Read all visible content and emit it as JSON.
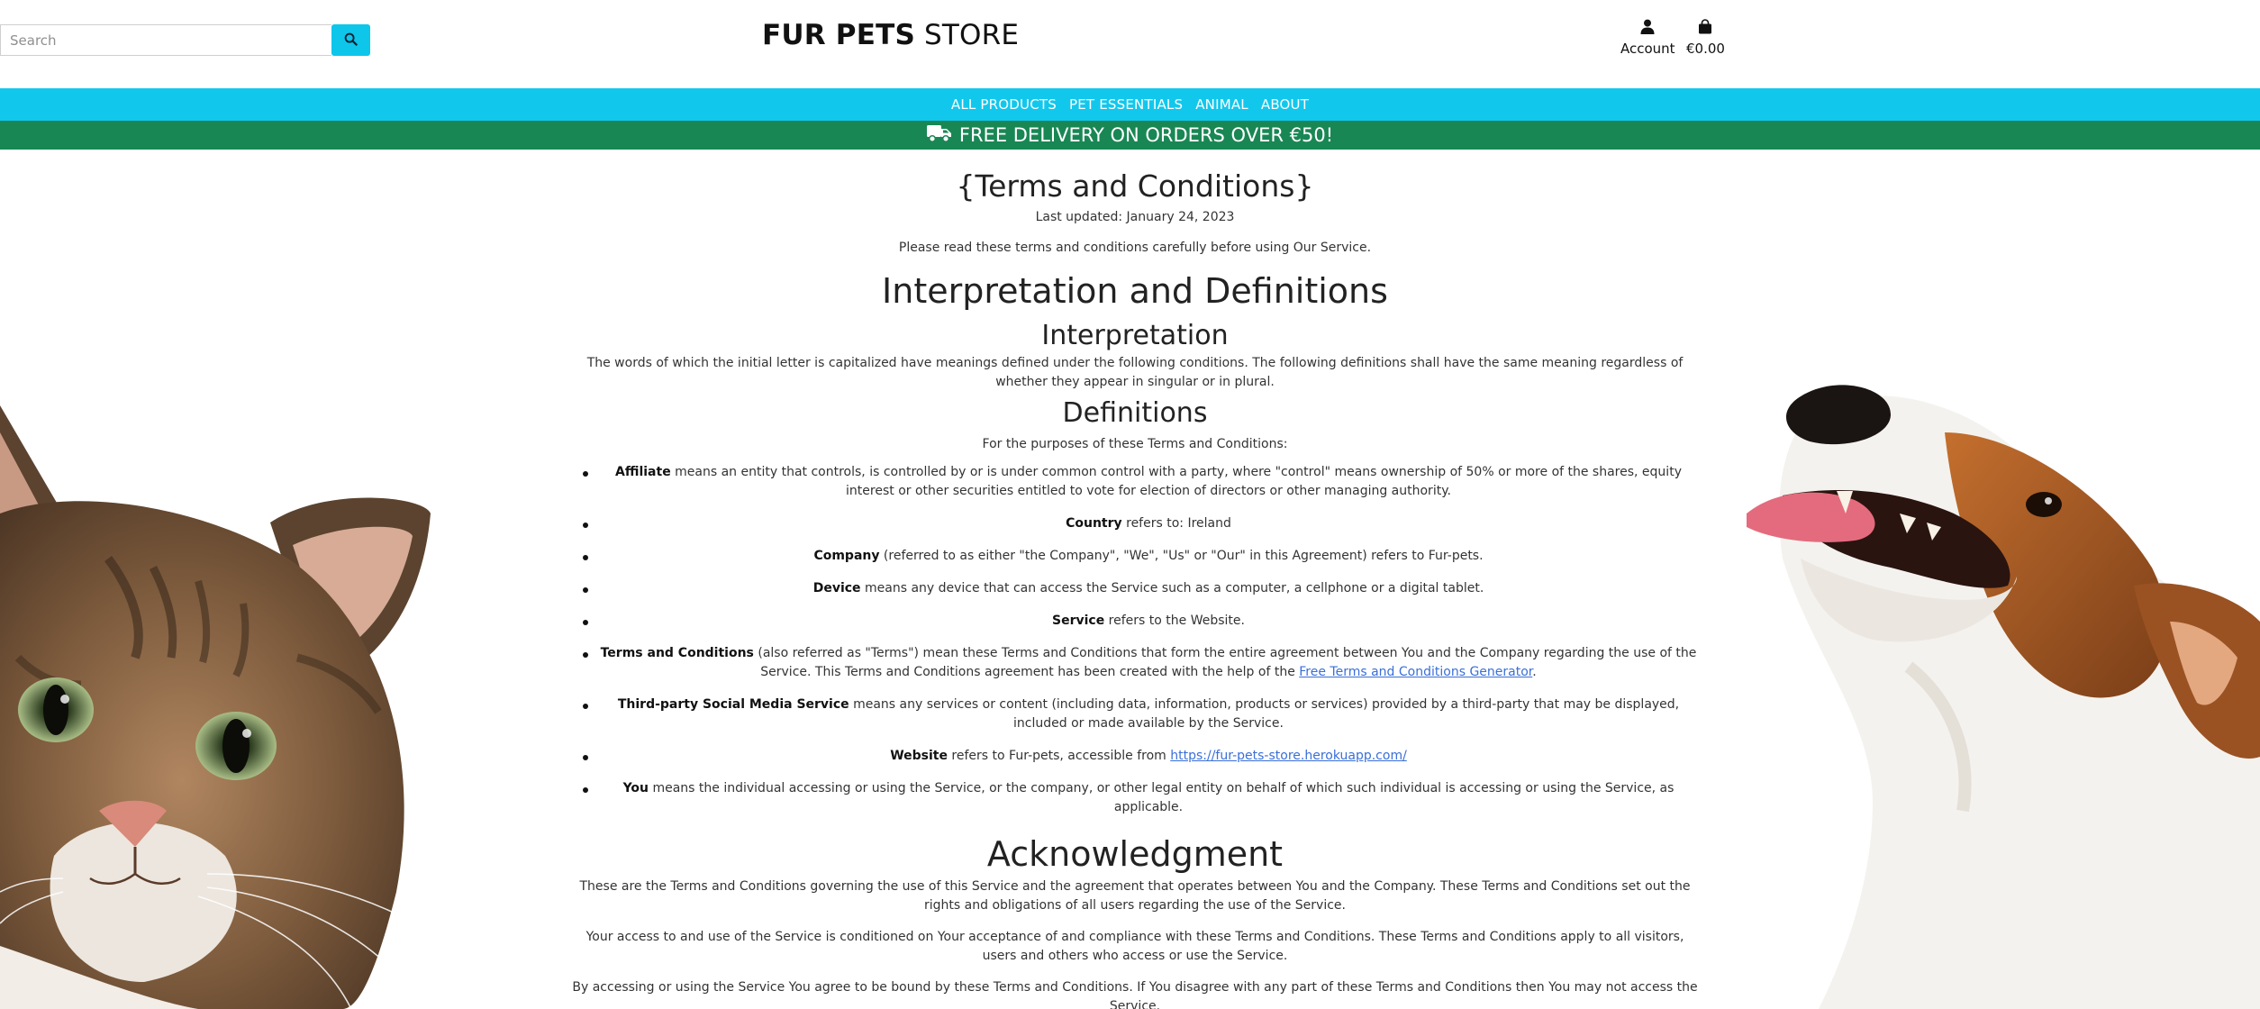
{
  "header": {
    "search_placeholder": "Search",
    "logo_bold": "FUR PETS",
    "logo_light": "STORE",
    "account_label": "Account",
    "bag_total": "€0.00"
  },
  "nav": {
    "items": [
      "ALL PRODUCTS",
      "PET ESSENTIALS",
      "ANIMAL",
      "ABOUT"
    ]
  },
  "promo": {
    "text": "FREE DELIVERY ON ORDERS OVER €50!"
  },
  "content": {
    "title": "{Terms and Conditions}",
    "last_updated": "Last updated: January 24, 2023",
    "intro": "Please read these terms and conditions carefully before using Our Service.",
    "h_interp_defs": "Interpretation and Definitions",
    "h_interp": "Interpretation",
    "interp_text": "The words of which the initial letter is capitalized have meanings defined under the following conditions. The following definitions shall have the same meaning regardless of whether they appear in singular or in plural.",
    "h_defs": "Definitions",
    "defs_intro": "For the purposes of these Terms and Conditions:",
    "defs": [
      {
        "term": "Affiliate",
        "text": " means an entity that controls, is controlled by or is under common control with a party, where \"control\" means ownership of 50% or more of the shares, equity interest or other securities entitled to vote for election of directors or other managing authority."
      },
      {
        "term": "Country",
        "text": " refers to: Ireland"
      },
      {
        "term": "Company",
        "text": " (referred to as either \"the Company\", \"We\", \"Us\" or \"Our\" in this Agreement) refers to Fur-pets."
      },
      {
        "term": "Device",
        "text": " means any device that can access the Service such as a computer, a cellphone or a digital tablet."
      },
      {
        "term": "Service",
        "text": " refers to the Website."
      },
      {
        "term": "Terms and Conditions",
        "text": " (also referred as \"Terms\") mean these Terms and Conditions that form the entire agreement between You and the Company regarding the use of the Service. This Terms and Conditions agreement has been created with the help of the ",
        "link": "Free Terms and Conditions Generator",
        "tail": "."
      },
      {
        "term": "Third-party Social Media Service",
        "text": " means any services or content (including data, information, products or services) provided by a third-party that may be displayed, included or made available by the Service."
      },
      {
        "term": "Website",
        "text": " refers to Fur-pets, accessible from ",
        "link": "https://fur-pets-store.herokuapp.com/",
        "tail": ""
      },
      {
        "term": "You",
        "text": " means the individual accessing or using the Service, or the company, or other legal entity on behalf of which such individual is accessing or using the Service, as applicable."
      }
    ],
    "h_ack": "Acknowledgment",
    "ack_1": "These are the Terms and Conditions governing the use of this Service and the agreement that operates between You and the Company. These Terms and Conditions set out the rights and obligations of all users regarding the use of the Service.",
    "ack_2": "Your access to and use of the Service is conditioned on Your acceptance of and compliance with these Terms and Conditions. These Terms and Conditions apply to all visitors, users and others who access or use the Service.",
    "ack_3": "By accessing or using the Service You agree to be bound by these Terms and Conditions. If You disagree with any part of these Terms and Conditions then You may not access the Service."
  },
  "colors": {
    "nav_bg": "#12c7ec",
    "promo_bg": "#198754",
    "search_button": "#0ec6ea",
    "link": "#3a6fd8"
  },
  "icons": {
    "search": "magnifier-icon",
    "account": "user-icon",
    "bag": "shopping-bag-icon",
    "truck": "truck-icon"
  }
}
